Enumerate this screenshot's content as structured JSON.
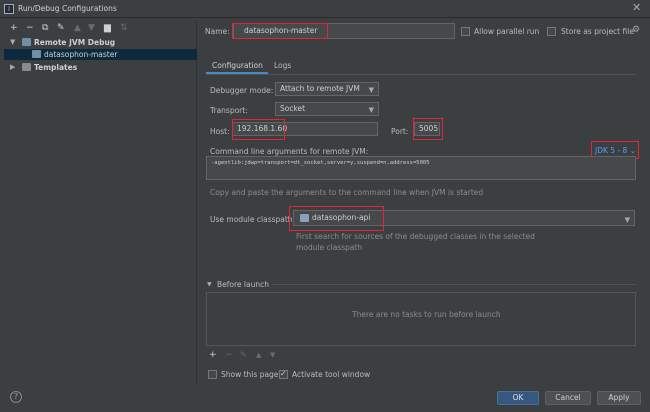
{
  "window": {
    "title": "Run/Debug Configurations",
    "app_icon_letter": "I"
  },
  "left_toolbar": [
    "+",
    "−",
    "⧉",
    "🔧",
    "▲",
    "▼",
    "📁",
    "⇅"
  ],
  "tree": {
    "group_remote": "Remote JVM Debug",
    "item_selected": "datasophon-master",
    "group_templates": "Templates"
  },
  "form": {
    "name_label": "Name:",
    "name_value": "datasophon-master",
    "allow_parallel_label": "Allow parallel run",
    "store_as_project_label": "Store as project file",
    "tabs": [
      "Configuration",
      "Logs"
    ],
    "debugger_mode_label": "Debugger mode:",
    "debugger_mode_value": "Attach to remote JVM",
    "transport_label": "Transport:",
    "transport_value": "Socket",
    "host_label": "Host:",
    "host_value": "192.168.1.60",
    "port_label": "Port:",
    "port_value": "5005",
    "cmd_label": "Command line arguments for remote JVM:",
    "jdk_value": "JDK 5 - 8",
    "cmd_value": "-agentlib:jdwp=transport=dt_socket,server=y,suspend=n,address=5005",
    "cmd_hint": "Copy and paste the arguments to the command line when JVM is started",
    "module_label": "Use module classpath:",
    "module_value": "datasophon-api",
    "module_hint_1": "First search for sources of the debugged classes in the selected",
    "module_hint_2": "module classpath",
    "before_launch_label": "Before launch",
    "no_tasks_text": "There are no tasks to run before launch",
    "show_page_label": "Show this page",
    "activate_tool_label": "Activate tool window"
  },
  "buttons": {
    "ok": "OK",
    "cancel": "Cancel",
    "apply": "Apply",
    "help": "?"
  },
  "colors": {
    "background": "#3c3f41",
    "selection": "#0d293e",
    "accent": "#4a88c7",
    "highlight_box": "#e32636",
    "jdk_link": "#589df6"
  }
}
